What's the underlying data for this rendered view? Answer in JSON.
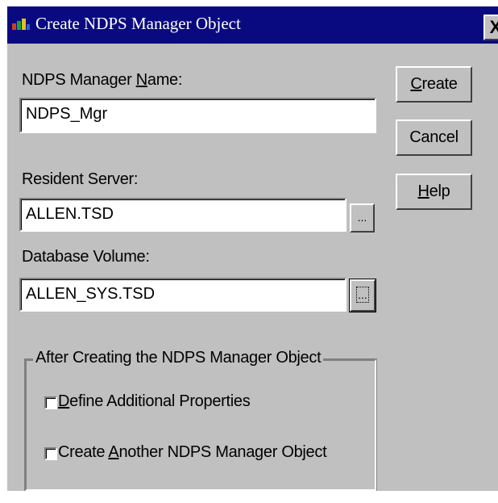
{
  "window": {
    "title": "Create NDPS Manager Object",
    "close_label": "X",
    "colors": {
      "titlebar": "#0a0a80",
      "face": "#c0c0c0",
      "field": "#ffffff"
    }
  },
  "form": {
    "manager_name": {
      "label_pre": "NDPS Manager ",
      "label_key": "N",
      "label_post": "ame:",
      "value": "NDPS_Mgr"
    },
    "resident_server": {
      "label": "Resident Server:",
      "value": "ALLEN.TSD",
      "browse_label": "..."
    },
    "database_volume": {
      "label": "Database Volume:",
      "value": "ALLEN_SYS.TSD",
      "browse_label": "..."
    }
  },
  "buttons": {
    "create": {
      "key": "C",
      "rest": "reate"
    },
    "cancel": {
      "label": "Cancel"
    },
    "help": {
      "key": "H",
      "rest": "elp"
    }
  },
  "after_group": {
    "caption": "After Creating the NDPS Manager Object",
    "define_props": {
      "key": "D",
      "rest": "efine Additional Properties",
      "checked": false
    },
    "create_another": {
      "pre": "Create ",
      "key": "A",
      "rest": "nother NDPS Manager Object",
      "checked": false
    }
  }
}
